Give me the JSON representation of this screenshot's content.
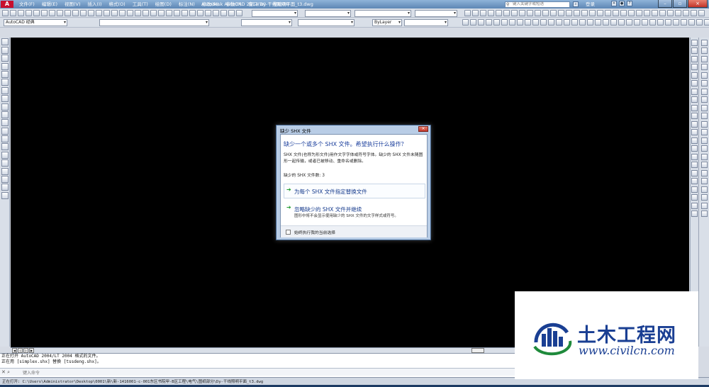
{
  "app": {
    "logo_text": "A",
    "window_title": "Autodesk AutoCAD 2014    Dy-干线照明平面_t3.dwg",
    "search_placeholder": "键入关键字或短语",
    "login_label": "登录",
    "menu": [
      "文件(F)",
      "编辑(E)",
      "视图(V)",
      "插入(I)",
      "格式(O)",
      "工具(T)",
      "绘图(D)",
      "标注(N)",
      "修改(M)",
      "参数(P)",
      "窗口(W)",
      "帮助(H)"
    ],
    "window_controls": [
      "–",
      "▫",
      "×"
    ]
  },
  "toolbar": {
    "workspace": "AutoCAD 经典",
    "linetype": "ByLayer"
  },
  "dialog": {
    "title": "缺少 SHX 文件",
    "close_label": "×",
    "heading": "缺少一个或多个 SHX 文件。希望执行什么操作？",
    "description": "SHX 文件(也称为形文件)用作文字字体或符号字体。缺少的 SHX 文件未随图形一起传输，或者已被移动、重命名或删除。",
    "count_label": "缺少的 SHX 文件数: 3",
    "option1": {
      "title": "为每个 SHX 文件指定替换文件"
    },
    "option2": {
      "title": "忽略缺少的 SHX 文件并继续",
      "subtitle": "图形中将不会显示使用缺少的 SHX 文件的文字样式或符号。"
    },
    "checkbox_label": "始终执行我的当前选择"
  },
  "command": {
    "history": [
      "正在打开 AutoCAD 2004/LT 2004 格式的文件。",
      "正在用 [simplex.shx] 替换 [tssdeng.shx]。"
    ],
    "input_placeholder": "键入命令"
  },
  "status_text": "正在打开: C:\\Users\\Administrator\\Desktop\\0001\\新\\新-1416001-c-001东区书院甲-B区工程\\电气\\图纸部分\\Dy-干线照明平面_t3.dwg",
  "watermark": {
    "brand": "土木工程网",
    "url": "www.civilcn.com"
  }
}
